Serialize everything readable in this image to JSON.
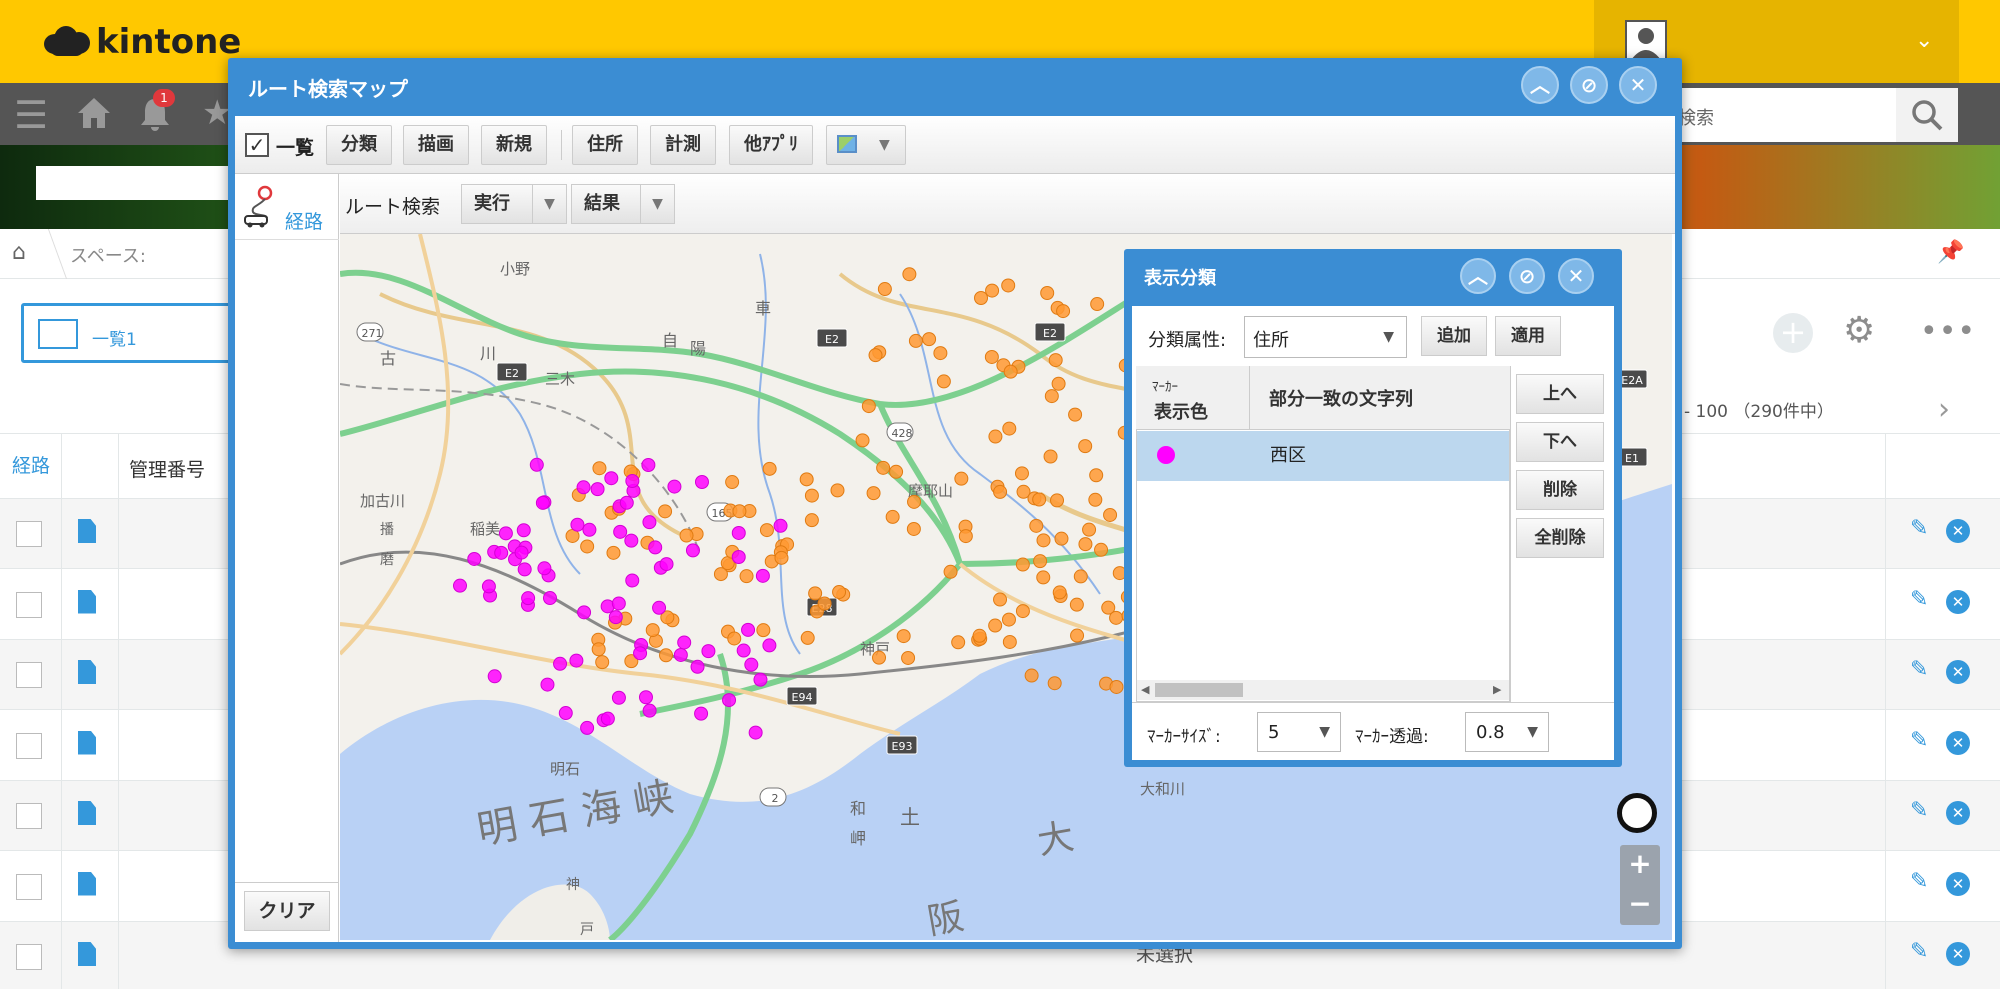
{
  "header": {
    "logo_text": "kintone",
    "notification_count": "1",
    "search_placeholder": "検索"
  },
  "breadcrumb": {
    "space_label": "スペース:"
  },
  "view": {
    "name": "一覧1",
    "pager_text": "- 100 （290件中）"
  },
  "table": {
    "col_route": "経路",
    "col_id": "管理番号",
    "row_count": 7,
    "visible_cell": "未選択"
  },
  "route_window": {
    "title": "ルート検索マップ",
    "toolbar": {
      "list_label": "一覧",
      "list_checked": true,
      "buttons": [
        "分類",
        "描画",
        "新規",
        "住所",
        "計測",
        "他ｱﾌﾟﾘ"
      ]
    },
    "sidebar": {
      "route_label": "経路",
      "clear_label": "クリア"
    },
    "route_bar": {
      "label": "ルート検索",
      "execute": "実行",
      "result": "結果"
    },
    "map": {
      "place_labels": [
        "小野",
        "三木",
        "加古川",
        "稲美",
        "明石",
        "摩耶山",
        "神戸",
        "明 石 海 峡",
        "大",
        "大和川",
        "阪",
        "土",
        "神",
        "戸",
        "自",
        "陽",
        "車",
        "古",
        "川",
        "播",
        "磨",
        "和",
        "岬"
      ],
      "road_labels": [
        "E2",
        "E2",
        "E2",
        "E28",
        "E94",
        "E93",
        "E2A",
        "E1",
        "428",
        "2",
        "271",
        "165"
      ],
      "marker_colors": {
        "orange": "#ff9933",
        "magenta": "#ff00ff"
      }
    }
  },
  "classification_dialog": {
    "title": "表示分類",
    "attribute_label": "分類属性:",
    "attribute_value": "住所",
    "add_label": "追加",
    "apply_label": "適用",
    "col_marker": [
      "ﾏｰｶｰ",
      "表示色"
    ],
    "col_match": "部分一致の文字列",
    "rows": [
      {
        "color": "#ff00ff",
        "text": "西区"
      }
    ],
    "side_buttons": [
      "上へ",
      "下へ",
      "削除",
      "全削除"
    ],
    "marker_size_label": "ﾏｰｶｰｻｲｽﾞ:",
    "marker_size_value": "5",
    "marker_opacity_label": "ﾏｰｶｰ透過:",
    "marker_opacity_value": "0.8"
  }
}
